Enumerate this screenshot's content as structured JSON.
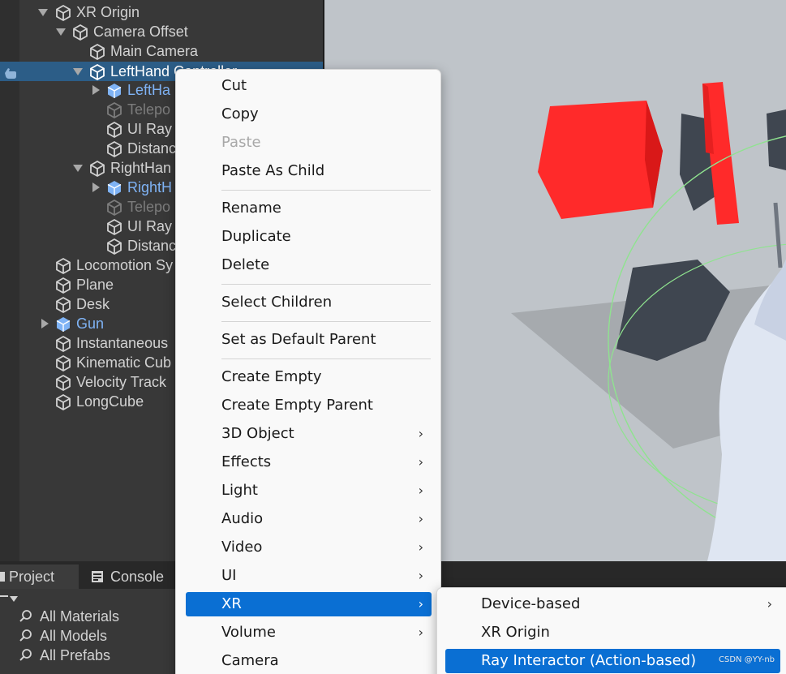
{
  "hierarchy": {
    "rows": [
      {
        "label": "XR Origin"
      },
      {
        "label": "Camera Offset"
      },
      {
        "label": "Main Camera"
      },
      {
        "label": "LeftHand Controller"
      },
      {
        "label": "LeftHa"
      },
      {
        "label": "Telepo"
      },
      {
        "label": "UI Ray"
      },
      {
        "label": "Distanc"
      },
      {
        "label": "RightHan"
      },
      {
        "label": "RightH"
      },
      {
        "label": "Telepo"
      },
      {
        "label": "UI Ray"
      },
      {
        "label": "Distanc"
      },
      {
        "label": "Locomotion Sy"
      },
      {
        "label": "Plane"
      },
      {
        "label": "Desk"
      },
      {
        "label": "Gun"
      },
      {
        "label": "Instantaneous"
      },
      {
        "label": "Kinematic Cub"
      },
      {
        "label": "Velocity Track"
      },
      {
        "label": "LongCube"
      }
    ]
  },
  "bottom_panel": {
    "tabs": [
      {
        "label": "Project",
        "icon": "folder-icon"
      },
      {
        "label": "Console",
        "icon": "console-icon"
      }
    ],
    "saved_searches": [
      {
        "label": "All Materials"
      },
      {
        "label": "All Models"
      },
      {
        "label": "All Prefabs"
      }
    ]
  },
  "context_menu": {
    "items": [
      {
        "label": "Cut"
      },
      {
        "label": "Copy"
      },
      {
        "label": "Paste",
        "disabled": true
      },
      {
        "label": "Paste As Child"
      },
      {
        "label": "Rename"
      },
      {
        "label": "Duplicate"
      },
      {
        "label": "Delete"
      },
      {
        "label": "Select Children"
      },
      {
        "label": "Set as Default Parent"
      },
      {
        "label": "Create Empty"
      },
      {
        "label": "Create Empty Parent"
      },
      {
        "label": "3D Object",
        "submenu": true
      },
      {
        "label": "Effects",
        "submenu": true
      },
      {
        "label": "Light",
        "submenu": true
      },
      {
        "label": "Audio",
        "submenu": true
      },
      {
        "label": "Video",
        "submenu": true
      },
      {
        "label": "UI",
        "submenu": true
      },
      {
        "label": "XR",
        "submenu": true,
        "highlighted": true
      },
      {
        "label": "Volume",
        "submenu": true
      },
      {
        "label": "Camera"
      }
    ],
    "chevron": "›"
  },
  "xr_submenu": {
    "items": [
      {
        "label": "Device-based",
        "submenu": true
      },
      {
        "label": "XR Origin"
      },
      {
        "label": "Ray Interactor (Action-based)",
        "highlighted": true
      }
    ]
  },
  "watermark": "CSDN @YY-nb",
  "colors": {
    "hierarchy_bg": "#383838",
    "selection": "#2c5d87",
    "prefab_text": "#7fb3f5",
    "menu_bg": "#f9f9f9",
    "menu_highlight": "#0a6fd3",
    "cube_red": "#ff2a2a",
    "scene_bg": "#bfc4c9"
  }
}
